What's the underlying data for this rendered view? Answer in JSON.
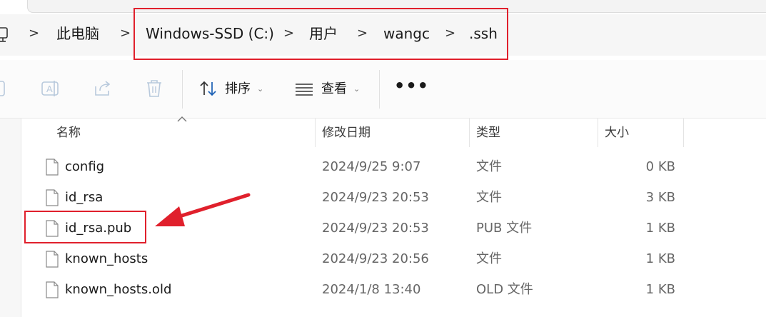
{
  "breadcrumb": {
    "items": [
      "此电脑",
      "Windows-SSD (C:)",
      "用户",
      "wangc",
      ".ssh"
    ],
    "separator": ">"
  },
  "toolbar": {
    "sort_label": "排序",
    "view_label": "查看",
    "more_label": "•••"
  },
  "columns": [
    "名称",
    "修改日期",
    "类型",
    "大小"
  ],
  "files": [
    {
      "name": "config",
      "date": "2024/9/25 9:07",
      "type": "文件",
      "size": "0 KB"
    },
    {
      "name": "id_rsa",
      "date": "2024/9/23 20:53",
      "type": "文件",
      "size": "3 KB"
    },
    {
      "name": "id_rsa.pub",
      "date": "2024/9/23 20:53",
      "type": "PUB 文件",
      "size": "1 KB"
    },
    {
      "name": "known_hosts",
      "date": "2024/9/23 20:56",
      "type": "文件",
      "size": "1 KB"
    },
    {
      "name": "known_hosts.old",
      "date": "2024/1/8 13:40",
      "type": "OLD 文件",
      "size": "1 KB"
    }
  ],
  "colors": {
    "annotation": "#e0202c",
    "accent": "#1a5fb4"
  }
}
